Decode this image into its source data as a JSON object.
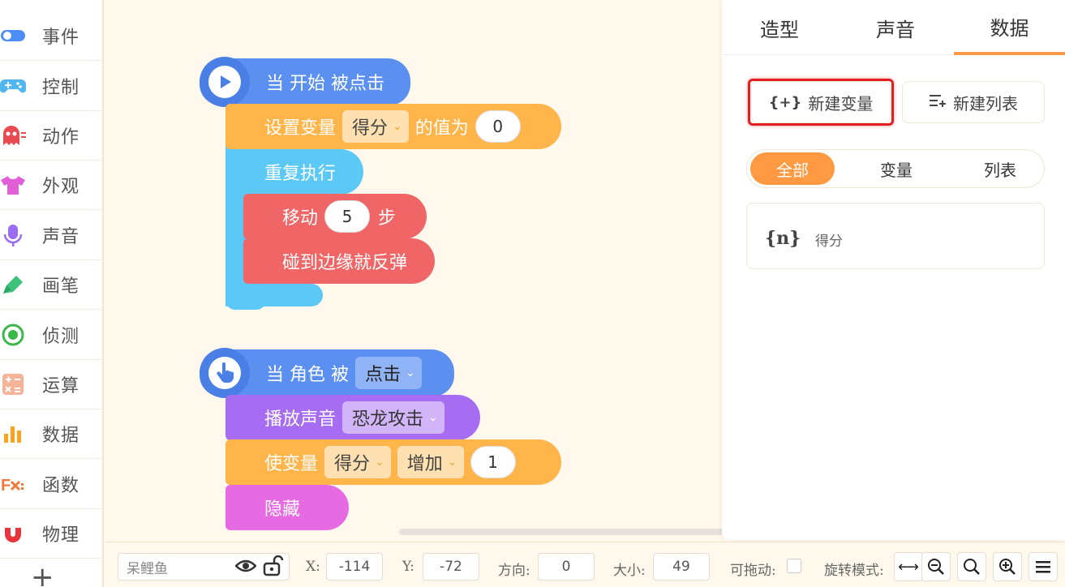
{
  "sidebar": {
    "items": [
      {
        "label": "事件",
        "icon": "toggle-icon",
        "color": "#4e8df5"
      },
      {
        "label": "控制",
        "icon": "gamepad-icon",
        "color": "#4fb6f0"
      },
      {
        "label": "动作",
        "icon": "ghost-icon",
        "color": "#e94b52"
      },
      {
        "label": "外观",
        "icon": "tshirt-icon",
        "color": "#e35fd8"
      },
      {
        "label": "声音",
        "icon": "microphone-icon",
        "color": "#9b6df0"
      },
      {
        "label": "画笔",
        "icon": "pen-icon",
        "color": "#3cc27a"
      },
      {
        "label": "侦测",
        "icon": "target-icon",
        "color": "#3cb84a"
      },
      {
        "label": "运算",
        "icon": "calculator-icon",
        "color": "#f19a7a"
      },
      {
        "label": "数据",
        "icon": "bar-chart-icon",
        "color": "#f7a320"
      },
      {
        "label": "函数",
        "icon": "function-icon",
        "color": "#f07a3a"
      },
      {
        "label": "物理",
        "icon": "magnet-icon",
        "color": "#e8343c"
      }
    ],
    "add": "+"
  },
  "script1": {
    "hat": "当 开始 被点击",
    "set_var_label": "设置变量",
    "set_var_name": "得分",
    "set_var_to": "的值为",
    "set_var_value": "0",
    "repeat": "重复执行",
    "move_label": "移动",
    "move_steps": "5",
    "move_unit": "步",
    "bounce": "碰到边缘就反弹"
  },
  "script2": {
    "hat_prefix": "当 角色 被",
    "hat_event": "点击",
    "play_sound_label": "播放声音",
    "sound_name": "恐龙攻击",
    "change_var_label": "使变量",
    "change_var_name": "得分",
    "change_op": "增加",
    "change_value": "1",
    "hide": "隐藏"
  },
  "panel": {
    "tabs": [
      "造型",
      "声音",
      "数据"
    ],
    "active_tab": "数据",
    "new_variable": "新建变量",
    "new_list": "新建列表",
    "filters": [
      "全部",
      "变量",
      "列表"
    ],
    "variable_icon": "{n}",
    "variable_name": "得分"
  },
  "bottombar": {
    "sprite_name": "呆鲤鱼",
    "x_label": "X:",
    "x_value": "-114",
    "y_label": "Y:",
    "y_value": "-72",
    "direction_label": "方向:",
    "direction_value": "0",
    "size_label": "大小:",
    "size_value": "49",
    "draggable_label": "可拖动:",
    "rotation_label": "旋转模式:"
  },
  "colors": {
    "event_blue": "#5b8ff0",
    "variable_orange": "#ffb54a",
    "control_cyan": "#5cc8f5",
    "motion_red": "#f06565",
    "sound_purple": "#a66cf2",
    "looks_pink": "#e66be3",
    "accent": "#ff9a42",
    "highlight_red": "#e02020"
  }
}
